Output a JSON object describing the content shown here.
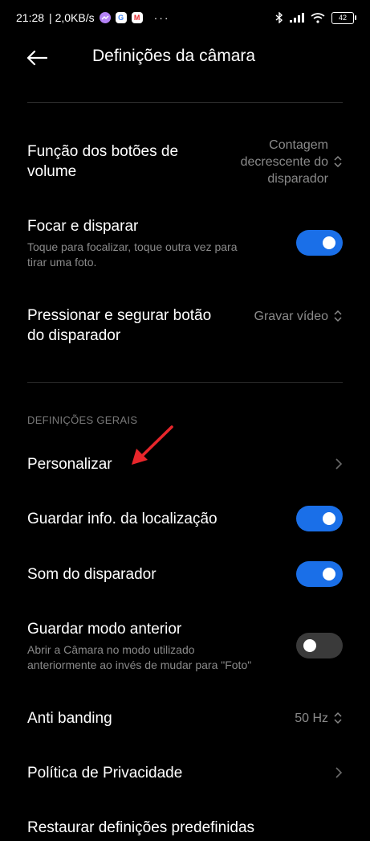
{
  "status_bar": {
    "time": "21:28",
    "network_speed": "| 2,0KB/s",
    "more": "···",
    "battery": "42",
    "icons": [
      "messenger-icon",
      "google-icon",
      "gmail-icon",
      "bluetooth-icon",
      "signal-icon",
      "wifi-icon",
      "battery-icon"
    ]
  },
  "header": {
    "title": "Definições da câmara",
    "back_icon": "arrow-left-icon"
  },
  "settings": {
    "volume_buttons": {
      "title_line1": "Função dos botões de",
      "title_line2": "volume",
      "value_line1": "Contagem",
      "value_line2": "decrescente do",
      "value_line3": "disparador"
    },
    "focus_shoot": {
      "title": "Focar e disparar",
      "sub_line1": "Toque para focalizar, toque outra vez para",
      "sub_line2": "tirar uma foto.",
      "enabled": true
    },
    "press_hold": {
      "title_line1": "Pressionar e segurar botão",
      "title_line2": "do disparador",
      "value": "Gravar vídeo"
    }
  },
  "general": {
    "section_label": "DEFINIÇÕES GERAIS",
    "customize": {
      "title": "Personalizar"
    },
    "save_location": {
      "title": "Guardar info. da localização",
      "enabled": true
    },
    "shutter_sound": {
      "title": "Som do disparador",
      "enabled": true
    },
    "save_previous_mode": {
      "title": "Guardar modo anterior",
      "sub_line1": "Abrir a Câmara no modo utilizado",
      "sub_line2": "anteriormente ao invés de mudar para \"Foto\"",
      "enabled": false
    },
    "anti_banding": {
      "title": "Anti banding",
      "value": "50 Hz"
    },
    "privacy": {
      "title": "Política de Privacidade"
    },
    "restore": {
      "title": "Restaurar definições predefinidas"
    }
  },
  "colors": {
    "background": "#000000",
    "toggle_on": "#1a6fe8",
    "toggle_off": "#3a3a3a",
    "annotation_arrow": "#e8262b",
    "secondary_text": "#8a8a8a"
  }
}
